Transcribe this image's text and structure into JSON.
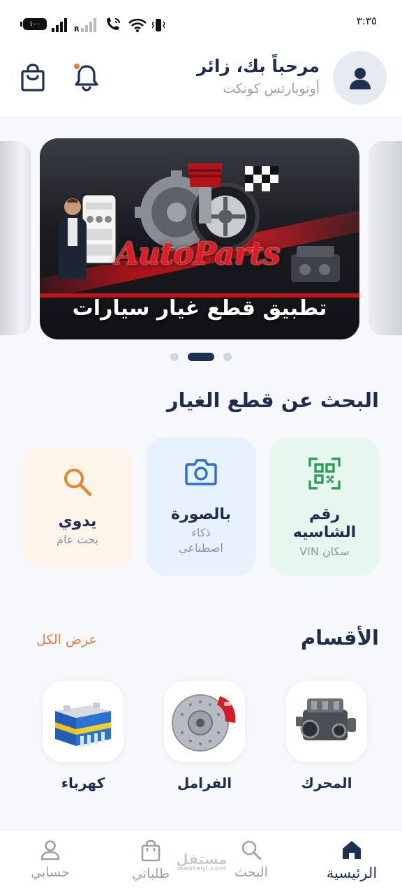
{
  "status_bar": {
    "time": "٣:٣٥",
    "battery": "١٠٠"
  },
  "header": {
    "greeting": "مرحباً بك، زائر",
    "app_name": "أوتوبارتس كونكت"
  },
  "banner": {
    "logo_text": "AutoParts",
    "title": "تطبيق قطع غيار سيارات",
    "slide_count": 3,
    "active_slide": 2
  },
  "search_section": {
    "title": "البحث عن قطع الغيار",
    "cards": [
      {
        "title": "رقم الشاسيه",
        "subtitle": "سكان VIN",
        "icon": "qr-code-icon",
        "color": "#2e9e5b"
      },
      {
        "title": "بالصورة",
        "subtitle": "ذكاء اصطناعي",
        "icon": "camera-icon",
        "color": "#2a6fd6"
      },
      {
        "title": "يدوي",
        "subtitle": "بحث عام",
        "icon": "search-icon",
        "color": "#e08a2c"
      }
    ]
  },
  "categories": {
    "title": "الأقسام",
    "view_all": "عرض الكل",
    "items": [
      {
        "label": "المحرك",
        "icon": "engine-icon"
      },
      {
        "label": "الفرامل",
        "icon": "brake-disc-icon"
      },
      {
        "label": "كهرباء",
        "icon": "battery-icon"
      }
    ]
  },
  "bottom_nav": {
    "items": [
      {
        "label": "الرئيسية",
        "icon": "home-icon",
        "active": true
      },
      {
        "label": "البحث",
        "icon": "search-icon",
        "active": false
      },
      {
        "label": "طلباتي",
        "icon": "shopping-bag-icon",
        "active": false
      },
      {
        "label": "حسابي",
        "icon": "user-icon",
        "active": false
      }
    ]
  },
  "watermark": {
    "arabic": "مستقل",
    "latin": "mostaql.com"
  },
  "colors": {
    "primary": "#1e3155",
    "accent": "#e07b46",
    "notification_dot": "#f07a3a",
    "vin_card_bg": "#e7f7ef",
    "photo_card_bg": "#e8f1fe",
    "manual_card_bg": "#fef4ea"
  }
}
